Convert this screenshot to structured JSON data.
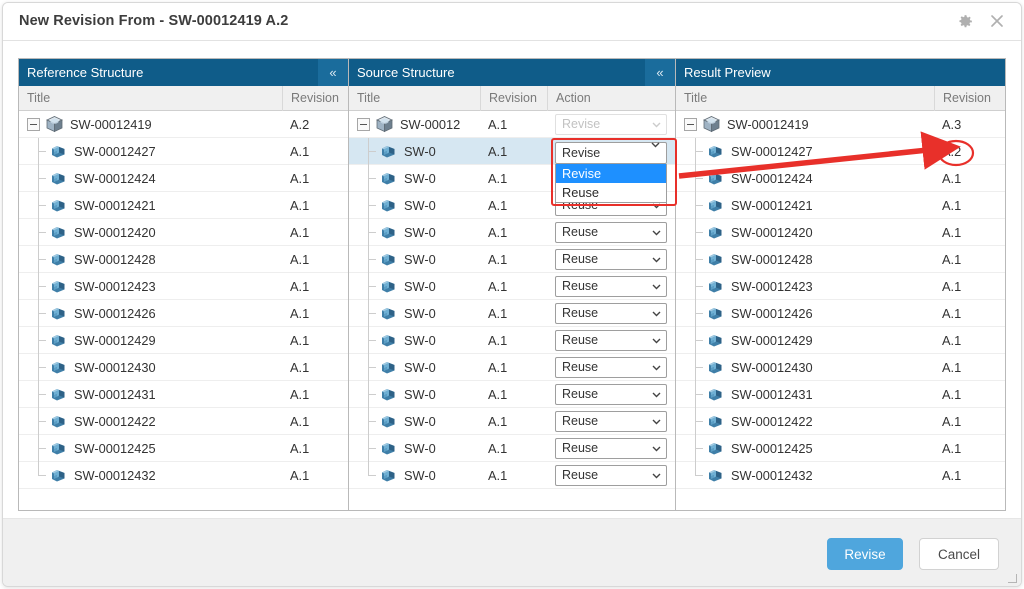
{
  "dialog": {
    "title": "New Revision From - SW-00012419 A.2",
    "settings_icon": "gear-icon",
    "close_icon": "close-icon"
  },
  "panels": {
    "reference": {
      "header": "Reference Structure",
      "collapse_label": "«",
      "columns": [
        "Title",
        "Revision"
      ],
      "rows": [
        {
          "title": "SW-00012419",
          "revision": "A.2",
          "root": true
        },
        {
          "title": "SW-00012427",
          "revision": "A.1"
        },
        {
          "title": "SW-00012424",
          "revision": "A.1"
        },
        {
          "title": "SW-00012421",
          "revision": "A.1"
        },
        {
          "title": "SW-00012420",
          "revision": "A.1"
        },
        {
          "title": "SW-00012428",
          "revision": "A.1"
        },
        {
          "title": "SW-00012423",
          "revision": "A.1"
        },
        {
          "title": "SW-00012426",
          "revision": "A.1"
        },
        {
          "title": "SW-00012429",
          "revision": "A.1"
        },
        {
          "title": "SW-00012430",
          "revision": "A.1"
        },
        {
          "title": "SW-00012431",
          "revision": "A.1"
        },
        {
          "title": "SW-00012422",
          "revision": "A.1"
        },
        {
          "title": "SW-00012425",
          "revision": "A.1"
        },
        {
          "title": "SW-00012432",
          "revision": "A.1"
        }
      ]
    },
    "source": {
      "header": "Source Structure",
      "collapse_label": "«",
      "columns": [
        "Title",
        "Revision",
        "Action"
      ],
      "rows": [
        {
          "title": "SW-00012",
          "revision": "A.1",
          "action": "Revise",
          "root": true,
          "disabled": true
        },
        {
          "title": "SW-0",
          "revision": "A.1",
          "action": "Revise",
          "selected": true,
          "open": true
        },
        {
          "title": "SW-0",
          "revision": "A.1",
          "action": "Reuse"
        },
        {
          "title": "SW-0",
          "revision": "A.1",
          "action": "Reuse"
        },
        {
          "title": "SW-0",
          "revision": "A.1",
          "action": "Reuse"
        },
        {
          "title": "SW-0",
          "revision": "A.1",
          "action": "Reuse"
        },
        {
          "title": "SW-0",
          "revision": "A.1",
          "action": "Reuse"
        },
        {
          "title": "SW-0",
          "revision": "A.1",
          "action": "Reuse"
        },
        {
          "title": "SW-0",
          "revision": "A.1",
          "action": "Reuse"
        },
        {
          "title": "SW-0",
          "revision": "A.1",
          "action": "Reuse"
        },
        {
          "title": "SW-0",
          "revision": "A.1",
          "action": "Reuse"
        },
        {
          "title": "SW-0",
          "revision": "A.1",
          "action": "Reuse"
        },
        {
          "title": "SW-0",
          "revision": "A.1",
          "action": "Reuse"
        },
        {
          "title": "SW-0",
          "revision": "A.1",
          "action": "Reuse"
        }
      ],
      "dropdown": {
        "value": "Revise",
        "options": [
          "Revise",
          "Reuse"
        ],
        "highlighted": "Revise"
      }
    },
    "result": {
      "header": "Result Preview",
      "columns": [
        "Title",
        "Revision"
      ],
      "rows": [
        {
          "title": "SW-00012419",
          "revision": "A.3",
          "root": true
        },
        {
          "title": "SW-00012427",
          "revision": "A.2",
          "highlighted": true
        },
        {
          "title": "SW-00012424",
          "revision": "A.1"
        },
        {
          "title": "SW-00012421",
          "revision": "A.1"
        },
        {
          "title": "SW-00012420",
          "revision": "A.1"
        },
        {
          "title": "SW-00012428",
          "revision": "A.1"
        },
        {
          "title": "SW-00012423",
          "revision": "A.1"
        },
        {
          "title": "SW-00012426",
          "revision": "A.1"
        },
        {
          "title": "SW-00012429",
          "revision": "A.1"
        },
        {
          "title": "SW-00012430",
          "revision": "A.1"
        },
        {
          "title": "SW-00012431",
          "revision": "A.1"
        },
        {
          "title": "SW-00012422",
          "revision": "A.1"
        },
        {
          "title": "SW-00012425",
          "revision": "A.1"
        },
        {
          "title": "SW-00012432",
          "revision": "A.1"
        }
      ]
    }
  },
  "footer": {
    "revise_label": "Revise",
    "cancel_label": "Cancel"
  },
  "colors": {
    "panel_header": "#0f5c89",
    "primary_button": "#4fa6dd",
    "annotation": "#e8302a",
    "option_highlight": "#1e90ff",
    "row_selected": "#d6e7f2"
  }
}
